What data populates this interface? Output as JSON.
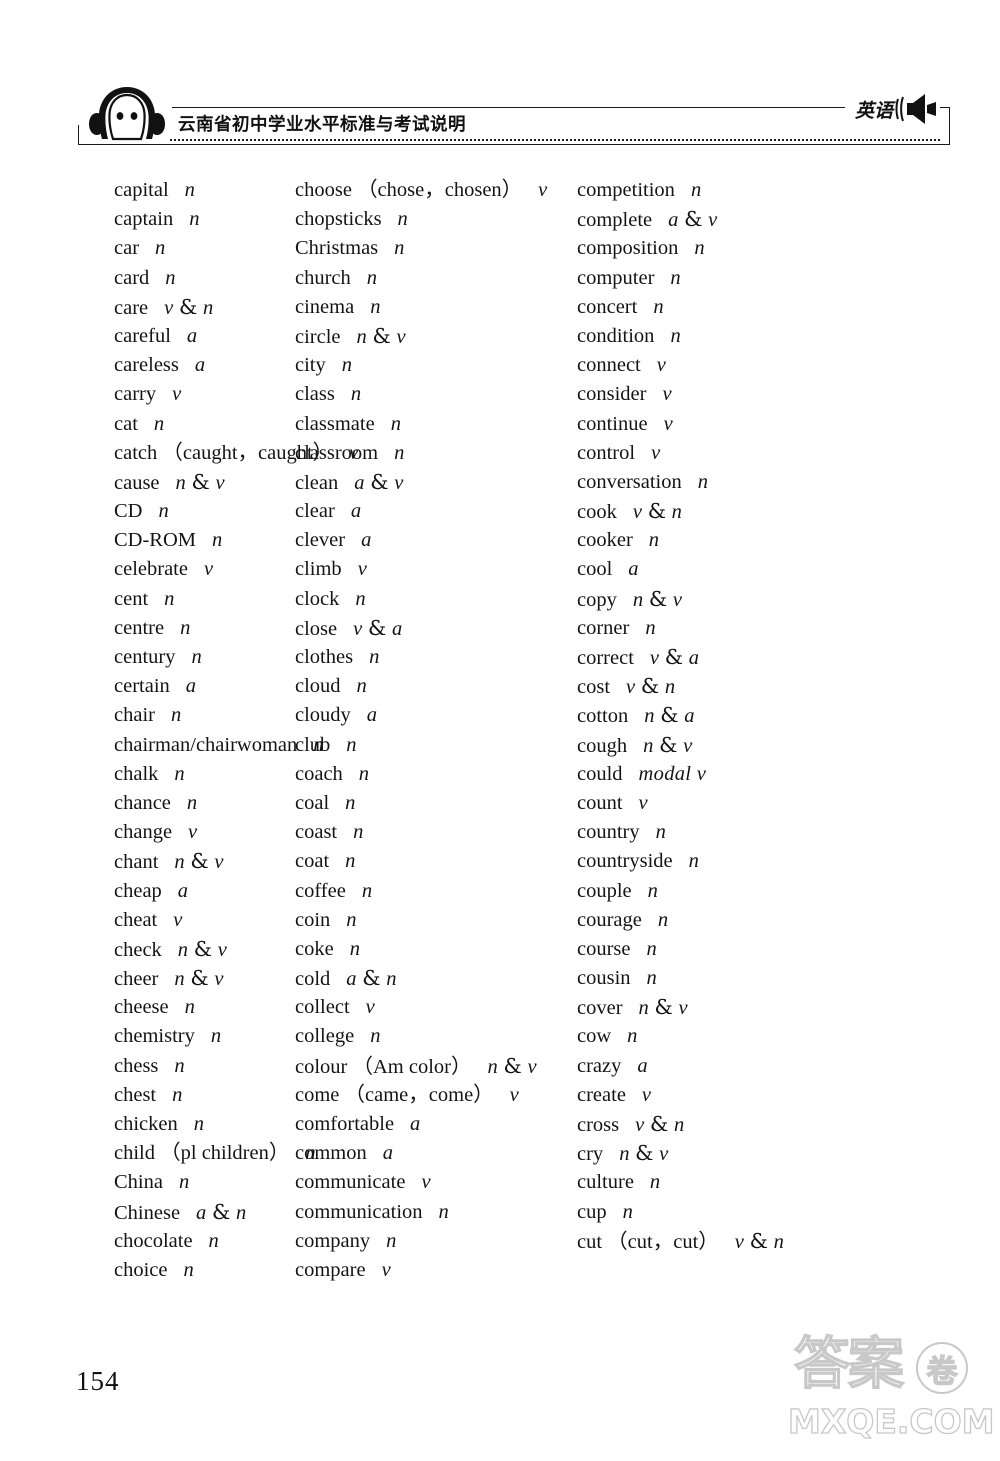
{
  "header": {
    "title": "云南省初中学业水平标准与考试说明",
    "subject": "英语",
    "face_icon": "headphones-face-icon",
    "speaker_icon": "speaker-icon"
  },
  "footer": {
    "page_number": "154"
  },
  "watermark": {
    "text_cn": "答案",
    "circle_char": "卷",
    "domain": "MXQE.COM"
  },
  "columns": [
    {
      "id": "column-1",
      "entries": [
        {
          "term": "capital",
          "forms": "",
          "pos": "n"
        },
        {
          "term": "captain",
          "forms": "",
          "pos": "n"
        },
        {
          "term": "car",
          "forms": "",
          "pos": "n"
        },
        {
          "term": "card",
          "forms": "",
          "pos": "n"
        },
        {
          "term": "care",
          "forms": "",
          "pos": "v & n"
        },
        {
          "term": "careful",
          "forms": "",
          "pos": "a"
        },
        {
          "term": "careless",
          "forms": "",
          "pos": "a"
        },
        {
          "term": "carry",
          "forms": "",
          "pos": "v"
        },
        {
          "term": "cat",
          "forms": "",
          "pos": "n"
        },
        {
          "term": "catch",
          "forms": "（caught，caught）",
          "pos": "v"
        },
        {
          "term": "cause",
          "forms": "",
          "pos": "n & v"
        },
        {
          "term": "CD",
          "forms": "",
          "pos": "n"
        },
        {
          "term": "CD-ROM",
          "forms": "",
          "pos": "n"
        },
        {
          "term": "celebrate",
          "forms": "",
          "pos": "v"
        },
        {
          "term": "cent",
          "forms": "",
          "pos": "n"
        },
        {
          "term": "centre",
          "forms": "",
          "pos": "n"
        },
        {
          "term": "century",
          "forms": "",
          "pos": "n"
        },
        {
          "term": "certain",
          "forms": "",
          "pos": "a"
        },
        {
          "term": "chair",
          "forms": "",
          "pos": "n"
        },
        {
          "term": "chairman/chairwoman",
          "forms": "",
          "pos": "n"
        },
        {
          "term": "chalk",
          "forms": "",
          "pos": "n"
        },
        {
          "term": "chance",
          "forms": "",
          "pos": "n"
        },
        {
          "term": "change",
          "forms": "",
          "pos": "v"
        },
        {
          "term": "chant",
          "forms": "",
          "pos": "n & v"
        },
        {
          "term": "cheap",
          "forms": "",
          "pos": "a"
        },
        {
          "term": "cheat",
          "forms": "",
          "pos": "v"
        },
        {
          "term": "check",
          "forms": "",
          "pos": "n & v"
        },
        {
          "term": "cheer",
          "forms": "",
          "pos": "n & v"
        },
        {
          "term": "cheese",
          "forms": "",
          "pos": "n"
        },
        {
          "term": "chemistry",
          "forms": "",
          "pos": "n"
        },
        {
          "term": "chess",
          "forms": "",
          "pos": "n"
        },
        {
          "term": "chest",
          "forms": "",
          "pos": "n"
        },
        {
          "term": "chicken",
          "forms": "",
          "pos": "n"
        },
        {
          "term": "child",
          "forms": "（pl children）",
          "pos": "n"
        },
        {
          "term": "China",
          "forms": "",
          "pos": "n"
        },
        {
          "term": "Chinese",
          "forms": "",
          "pos": "a & n"
        },
        {
          "term": "chocolate",
          "forms": "",
          "pos": "n"
        },
        {
          "term": "choice",
          "forms": "",
          "pos": "n"
        }
      ]
    },
    {
      "id": "column-2",
      "entries": [
        {
          "term": "choose",
          "forms": "（chose，chosen）",
          "pos": "v"
        },
        {
          "term": "chopsticks",
          "forms": "",
          "pos": "n"
        },
        {
          "term": "Christmas",
          "forms": "",
          "pos": "n"
        },
        {
          "term": "church",
          "forms": "",
          "pos": "n"
        },
        {
          "term": "cinema",
          "forms": "",
          "pos": "n"
        },
        {
          "term": "circle",
          "forms": "",
          "pos": "n & v"
        },
        {
          "term": "city",
          "forms": "",
          "pos": "n"
        },
        {
          "term": "class",
          "forms": "",
          "pos": "n"
        },
        {
          "term": "classmate",
          "forms": "",
          "pos": "n"
        },
        {
          "term": "classroom",
          "forms": "",
          "pos": "n"
        },
        {
          "term": "clean",
          "forms": "",
          "pos": "a & v"
        },
        {
          "term": "clear",
          "forms": "",
          "pos": "a"
        },
        {
          "term": "clever",
          "forms": "",
          "pos": "a"
        },
        {
          "term": "climb",
          "forms": "",
          "pos": "v"
        },
        {
          "term": "clock",
          "forms": "",
          "pos": "n"
        },
        {
          "term": "close",
          "forms": "",
          "pos": "v & a"
        },
        {
          "term": "clothes",
          "forms": "",
          "pos": "n"
        },
        {
          "term": "cloud",
          "forms": "",
          "pos": "n"
        },
        {
          "term": "cloudy",
          "forms": "",
          "pos": "a"
        },
        {
          "term": "club",
          "forms": "",
          "pos": "n"
        },
        {
          "term": "coach",
          "forms": "",
          "pos": "n"
        },
        {
          "term": "coal",
          "forms": "",
          "pos": "n"
        },
        {
          "term": "coast",
          "forms": "",
          "pos": "n"
        },
        {
          "term": "coat",
          "forms": "",
          "pos": "n"
        },
        {
          "term": "coffee",
          "forms": "",
          "pos": "n"
        },
        {
          "term": "coin",
          "forms": "",
          "pos": "n"
        },
        {
          "term": "coke",
          "forms": "",
          "pos": "n"
        },
        {
          "term": "cold",
          "forms": "",
          "pos": "a & n"
        },
        {
          "term": "collect",
          "forms": "",
          "pos": "v"
        },
        {
          "term": "college",
          "forms": "",
          "pos": "n"
        },
        {
          "term": "colour",
          "forms": "（Am color）",
          "pos": "n & v"
        },
        {
          "term": "come",
          "forms": "（came，come）",
          "pos": "v"
        },
        {
          "term": "comfortable",
          "forms": "",
          "pos": "a"
        },
        {
          "term": "common",
          "forms": "",
          "pos": "a"
        },
        {
          "term": "communicate",
          "forms": "",
          "pos": "v"
        },
        {
          "term": "communication",
          "forms": "",
          "pos": "n"
        },
        {
          "term": "company",
          "forms": "",
          "pos": "n"
        },
        {
          "term": "compare",
          "forms": "",
          "pos": "v"
        }
      ]
    },
    {
      "id": "column-3",
      "entries": [
        {
          "term": "competition",
          "forms": "",
          "pos": "n"
        },
        {
          "term": "complete",
          "forms": "",
          "pos": "a & v"
        },
        {
          "term": "composition",
          "forms": "",
          "pos": "n"
        },
        {
          "term": "computer",
          "forms": "",
          "pos": "n"
        },
        {
          "term": "concert",
          "forms": "",
          "pos": "n"
        },
        {
          "term": "condition",
          "forms": "",
          "pos": "n"
        },
        {
          "term": "connect",
          "forms": "",
          "pos": "v"
        },
        {
          "term": "consider",
          "forms": "",
          "pos": "v"
        },
        {
          "term": "continue",
          "forms": "",
          "pos": "v"
        },
        {
          "term": "control",
          "forms": "",
          "pos": "v"
        },
        {
          "term": "conversation",
          "forms": "",
          "pos": "n"
        },
        {
          "term": "cook",
          "forms": "",
          "pos": "v & n"
        },
        {
          "term": "cooker",
          "forms": "",
          "pos": "n"
        },
        {
          "term": "cool",
          "forms": "",
          "pos": "a"
        },
        {
          "term": "copy",
          "forms": "",
          "pos": "n & v"
        },
        {
          "term": "corner",
          "forms": "",
          "pos": "n"
        },
        {
          "term": "correct",
          "forms": "",
          "pos": "v & a"
        },
        {
          "term": "cost",
          "forms": "",
          "pos": "v & n"
        },
        {
          "term": "cotton",
          "forms": "",
          "pos": "n & a"
        },
        {
          "term": "cough",
          "forms": "",
          "pos": "n & v"
        },
        {
          "term": "could",
          "forms": "",
          "pos": "modal v"
        },
        {
          "term": "count",
          "forms": "",
          "pos": "v"
        },
        {
          "term": "country",
          "forms": "",
          "pos": "n"
        },
        {
          "term": "countryside",
          "forms": "",
          "pos": "n"
        },
        {
          "term": "couple",
          "forms": "",
          "pos": "n"
        },
        {
          "term": "courage",
          "forms": "",
          "pos": "n"
        },
        {
          "term": "course",
          "forms": "",
          "pos": "n"
        },
        {
          "term": "cousin",
          "forms": "",
          "pos": "n"
        },
        {
          "term": "cover",
          "forms": "",
          "pos": "n & v"
        },
        {
          "term": "cow",
          "forms": "",
          "pos": "n"
        },
        {
          "term": "crazy",
          "forms": "",
          "pos": "a"
        },
        {
          "term": "create",
          "forms": "",
          "pos": "v"
        },
        {
          "term": "cross",
          "forms": "",
          "pos": "v & n"
        },
        {
          "term": "cry",
          "forms": "",
          "pos": "n & v"
        },
        {
          "term": "culture",
          "forms": "",
          "pos": "n"
        },
        {
          "term": "cup",
          "forms": "",
          "pos": "n"
        },
        {
          "term": "cut",
          "forms": "（cut，cut）",
          "pos": "v & n"
        }
      ]
    }
  ]
}
